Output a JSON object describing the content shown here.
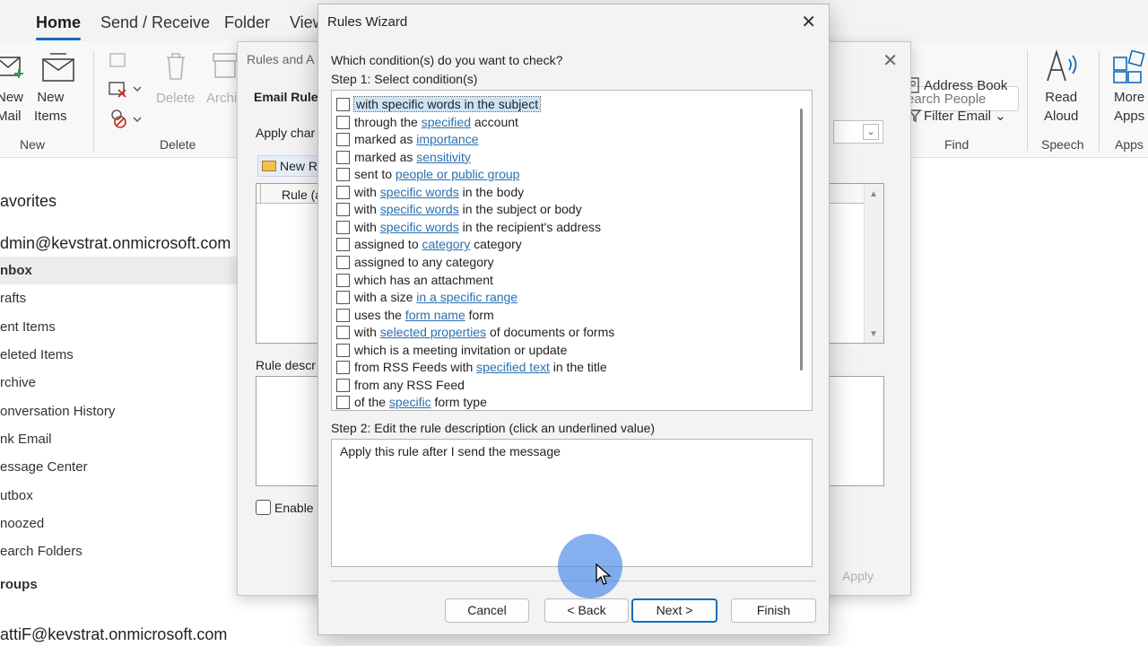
{
  "tabs": [
    "Home",
    "Send / Receive",
    "Folder",
    "View"
  ],
  "ribbon": {
    "new_mail": "New\nMail",
    "new_items": "New\nItems",
    "group_new": "New",
    "delete": "Delete",
    "archive": "Archi",
    "group_delete": "Delete",
    "search_people": "earch People",
    "address_book": "Address Book",
    "filter_email": "Filter Email",
    "group_find": "Find",
    "read_aloud": "Read\nAloud",
    "group_speech": "Speech",
    "more_apps": "More\nApps",
    "group_apps": "Apps"
  },
  "nav": {
    "favorites": "avorites",
    "account1": "dmin@kevstrat.onmicrosoft.com",
    "folders": [
      "nbox",
      "rafts",
      "ent Items",
      "eleted Items",
      "rchive",
      "onversation History",
      "nk Email",
      "essage Center",
      "utbox",
      "noozed",
      "earch Folders"
    ],
    "groups": "roups",
    "account2": "attiF@kevstrat.onmicrosoft.com"
  },
  "rules_alerts": {
    "title": "Rules and A",
    "tab": "Email Rules",
    "apply_changes": "Apply char",
    "new_rule": "New R",
    "rule_col": "Rule (a",
    "rule_desc": "Rule descr",
    "enable": "Enable",
    "apply": "Apply"
  },
  "wizard": {
    "title": "Rules Wizard",
    "question": "Which condition(s) do you want to check?",
    "step1": "Step 1: Select condition(s)",
    "conditions": [
      {
        "a": "with specific words in the subject",
        "link": "",
        "b": ""
      },
      {
        "a": "through the ",
        "link": "specified",
        "b": " account"
      },
      {
        "a": "marked as ",
        "link": "importance",
        "b": ""
      },
      {
        "a": "marked as ",
        "link": "sensitivity",
        "b": ""
      },
      {
        "a": "sent to ",
        "link": "people or public group",
        "b": ""
      },
      {
        "a": "with ",
        "link": "specific words",
        "b": " in the body"
      },
      {
        "a": "with ",
        "link": "specific words",
        "b": " in the subject or body"
      },
      {
        "a": "with ",
        "link": "specific words",
        "b": " in the recipient's address"
      },
      {
        "a": "assigned to ",
        "link": "category",
        "b": " category"
      },
      {
        "a": "assigned to any category",
        "link": "",
        "b": ""
      },
      {
        "a": "which has an attachment",
        "link": "",
        "b": ""
      },
      {
        "a": "with a size ",
        "link": "in a specific range",
        "b": ""
      },
      {
        "a": "uses the ",
        "link": "form name",
        "b": " form"
      },
      {
        "a": "with ",
        "link": "selected properties",
        "b": " of documents or forms"
      },
      {
        "a": "which is a meeting invitation or update",
        "link": "",
        "b": ""
      },
      {
        "a": "from RSS Feeds with ",
        "link": "specified text",
        "b": " in the title"
      },
      {
        "a": "from any RSS Feed",
        "link": "",
        "b": ""
      },
      {
        "a": "of the ",
        "link": "specific",
        "b": " form type"
      }
    ],
    "step2": "Step 2: Edit the rule description (click an underlined value)",
    "description": "Apply this rule after I send the message",
    "cancel": "Cancel",
    "back": "< Back",
    "next": "Next >",
    "finish": "Finish"
  },
  "colors": {
    "accent": "#0f6cbd",
    "link": "#2a6fb0",
    "selection": "#cce4f7"
  }
}
